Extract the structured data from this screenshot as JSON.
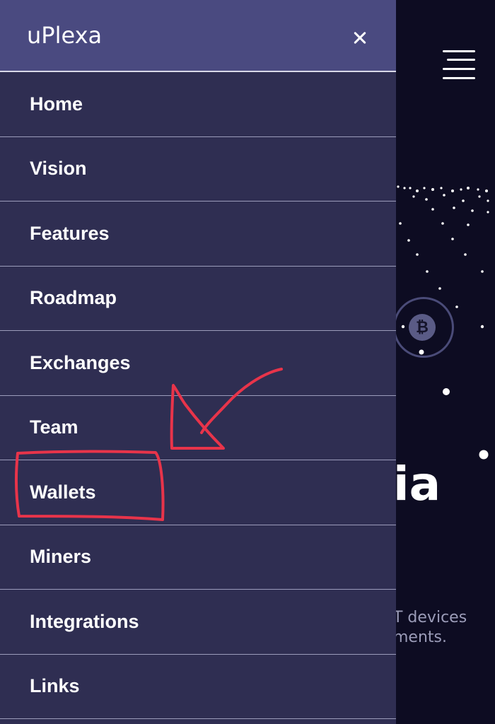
{
  "page": {
    "hero_fragment": "ia",
    "subtitle_lines": [
      "T devices",
      "ments."
    ],
    "coin_symbol": "₿"
  },
  "drawer": {
    "brand": "uPlexa",
    "close_icon": "close-icon",
    "items": [
      {
        "label": "Home"
      },
      {
        "label": "Vision"
      },
      {
        "label": "Features"
      },
      {
        "label": "Roadmap"
      },
      {
        "label": "Exchanges"
      },
      {
        "label": "Team"
      },
      {
        "label": "Wallets"
      },
      {
        "label": "Miners"
      },
      {
        "label": "Integrations"
      },
      {
        "label": "Links"
      }
    ]
  },
  "annotation": {
    "highlighted_item": "Wallets",
    "color": "#e8344a"
  },
  "colors": {
    "drawer_bg": "#2f2e52",
    "drawer_header_bg": "#4a4a80",
    "page_bg": "#0d0c22",
    "divider": "#9c9cbb"
  }
}
